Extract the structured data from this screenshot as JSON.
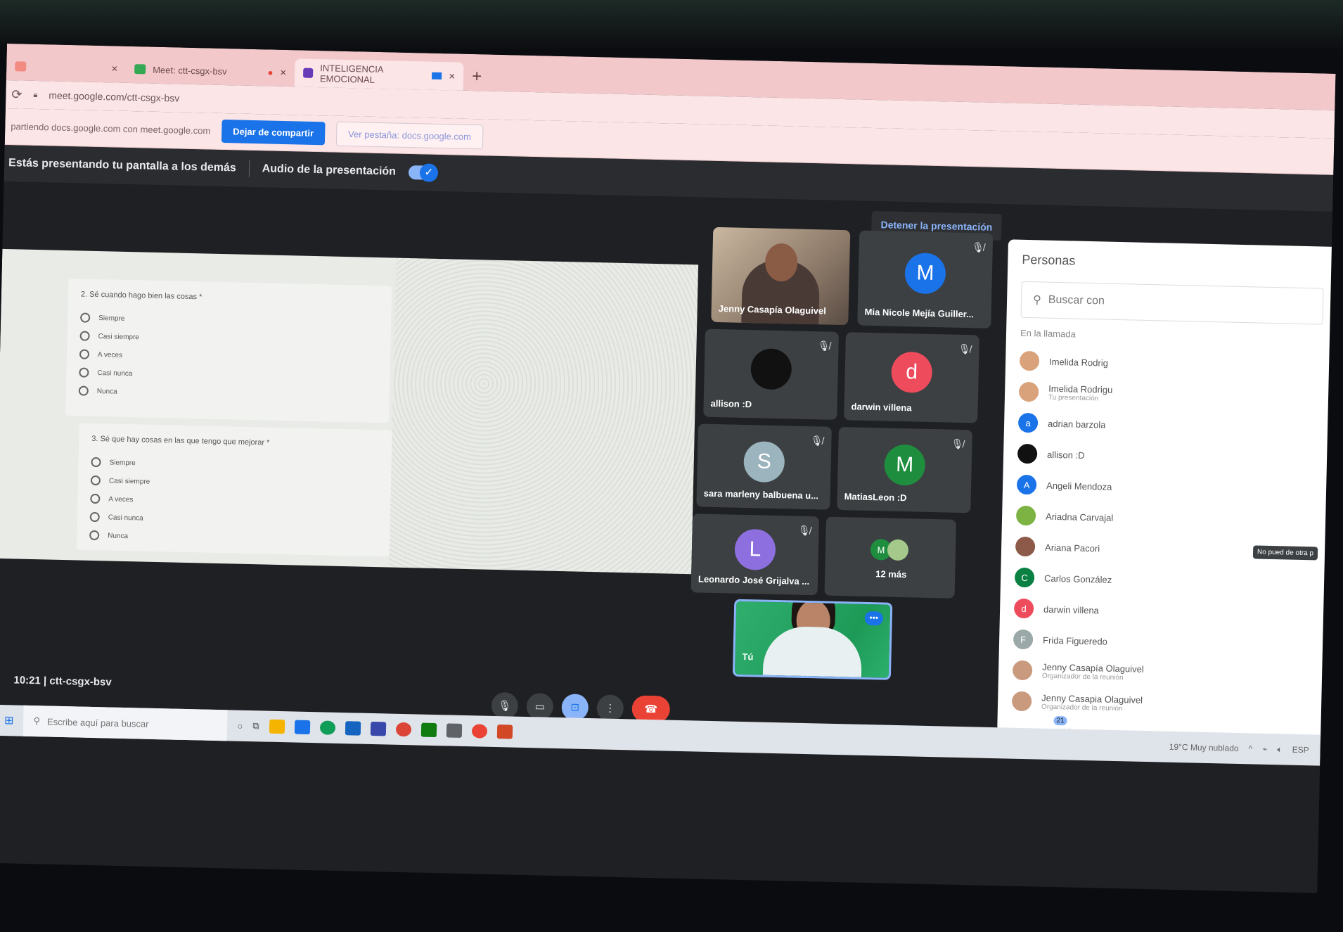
{
  "browser": {
    "tabs": [
      {
        "title": "",
        "favicon_color": "#f28b82"
      },
      {
        "title": "Meet: ctt-csgx-bsv",
        "favicon_color": "#34a853",
        "recording": true
      },
      {
        "title": "INTELIGENCIA EMOCIONAL",
        "favicon_color": "#673ab7",
        "sharing": true
      }
    ],
    "new_tab_label": "+",
    "close_glyph": "×",
    "url": "meet.google.com/ctt-csgx-bsv"
  },
  "share_bar": {
    "message": "partiendo docs.google.com con meet.google.com",
    "stop_button": "Dejar de compartir",
    "view_tab_button": "Ver pestaña: docs.google.com"
  },
  "present_bar": {
    "message": "Estás presentando tu pantalla a los demás",
    "audio_label": "Audio de la presentación",
    "audio_on": true,
    "stop_presenting": "Detener la presentación"
  },
  "shared_doc": {
    "questions": [
      {
        "title": "2. Sé cuando hago bien las cosas *",
        "options": [
          "Siempre",
          "Casi siempre",
          "A veces",
          "Casi nunca",
          "Nunca"
        ]
      },
      {
        "title": "3. Sé que hay cosas en las que tengo que mejorar *",
        "options": [
          "Siempre",
          "Casi siempre",
          "A veces",
          "Casi nunca",
          "Nunca"
        ]
      }
    ]
  },
  "tiles": [
    {
      "name": "Jenny Casapía Olaguivel",
      "type": "video"
    },
    {
      "name": "Mia Nicole Mejía Guiller...",
      "initial": "M",
      "color": "#1a73e8",
      "muted": true
    },
    {
      "name": "allison :D",
      "initial": "",
      "color": "#111111",
      "muted": true
    },
    {
      "name": "darwin villena",
      "initial": "d",
      "color": "#ee4b5c",
      "muted": true
    },
    {
      "name": "sara marleny balbuena u...",
      "initial": "S",
      "color": "#9bb4bd",
      "muted": true
    },
    {
      "name": "MatiasLeon :D",
      "initial": "M",
      "color": "#1e8e3e",
      "muted": true
    },
    {
      "name": "Leonardo José Grijalva ...",
      "initial": "L",
      "color": "#8e6fe0",
      "muted": true
    },
    {
      "name": "12 más",
      "initial": "M",
      "color": "#1e8e3e",
      "type": "overflow"
    },
    {
      "name": "Tú",
      "type": "self"
    }
  ],
  "people_panel": {
    "title": "Personas",
    "search_placeholder": "Buscar con",
    "section": "En la llamada",
    "participants": [
      {
        "name": "Imelida Rodrig",
        "sub": "",
        "color": "#d9a27a",
        "initial": ""
      },
      {
        "name": "Imelida Rodrigu",
        "sub": "Tu presentación",
        "color": "#d9a27a",
        "initial": ""
      },
      {
        "name": "adrian barzola",
        "sub": "",
        "color": "#1a73e8",
        "initial": "a"
      },
      {
        "name": "allison :D",
        "sub": "",
        "color": "#111111",
        "initial": ""
      },
      {
        "name": "Angeli Mendoza",
        "sub": "",
        "color": "#1a73e8",
        "initial": "A"
      },
      {
        "name": "Ariadna Carvajal",
        "sub": "",
        "color": "#7cb342",
        "initial": ""
      },
      {
        "name": "Ariana Pacori",
        "sub": "",
        "color": "#8d5a4a",
        "initial": "",
        "badge": "No pued de otra p"
      },
      {
        "name": "Carlos González",
        "sub": "",
        "color": "#0b8043",
        "initial": "C"
      },
      {
        "name": "darwin villena",
        "sub": "",
        "color": "#ee4b5c",
        "initial": "d"
      },
      {
        "name": "Frida Figueredo",
        "sub": "",
        "color": "#9aa8a8",
        "initial": "F"
      },
      {
        "name": "Jenny Casapía Olaguivel",
        "sub": "Organizador de la reunión",
        "color": "#c99a7e",
        "initial": ""
      },
      {
        "name": "Jenny Casapia Olaguivel",
        "sub": "Organizador de la reunión",
        "color": "#c99a7e",
        "initial": ""
      }
    ]
  },
  "meeting": {
    "time": "10:21",
    "code": "ctt-csgx-bsv",
    "people_count": "21"
  },
  "taskbar": {
    "search_placeholder": "Escribe aquí para buscar",
    "weather": "19°C  Muy nublado",
    "lang": "ESP"
  }
}
